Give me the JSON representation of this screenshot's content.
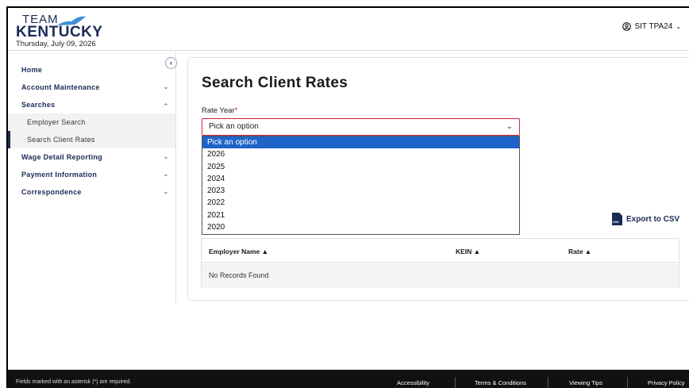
{
  "header": {
    "logo_team": "TEAM",
    "logo_state": "KENTUCKY",
    "date": "Thursday, July 09, 2026",
    "user_label": "SIT TPA24",
    "user_icon": "user-circle-icon",
    "colors": {
      "brand": "#1b2a55",
      "accent": "#1e63c8",
      "required": "#d0273e"
    }
  },
  "sidebar": {
    "items": [
      {
        "label": "Home"
      },
      {
        "label": "Account Maintenance",
        "icon": "chevron-down-icon"
      },
      {
        "label": "Searches",
        "icon": "chevron-up-icon"
      },
      {
        "label": "Employer Search"
      },
      {
        "label": "Search Client Rates"
      },
      {
        "label": "Wage Detail Reporting",
        "icon": "chevron-down-icon"
      },
      {
        "label": "Payment Information",
        "icon": "chevron-down-icon"
      },
      {
        "label": "Correspondence",
        "icon": "chevron-down-icon"
      }
    ]
  },
  "main": {
    "title": "Search Client Rates",
    "rate_year": {
      "label": "Rate Year",
      "required_mark": "*",
      "selected": "Pick an option",
      "options": [
        "Pick an option",
        "2026",
        "2025",
        "2024",
        "2023",
        "2022",
        "2021",
        "2020"
      ]
    },
    "export_label": "Export to CSV",
    "export_icon_text": "csv",
    "table": {
      "columns": [
        "Employer Name ▲",
        "KEIN ▲",
        "Rate ▲"
      ],
      "empty_text": "No Records Found"
    }
  },
  "footer": {
    "note": "Fields marked with an asterisk (*) are required.",
    "links": [
      "Accessibility",
      "Terms & Conditions",
      "Viewing Tips",
      "Privacy Policy"
    ]
  }
}
